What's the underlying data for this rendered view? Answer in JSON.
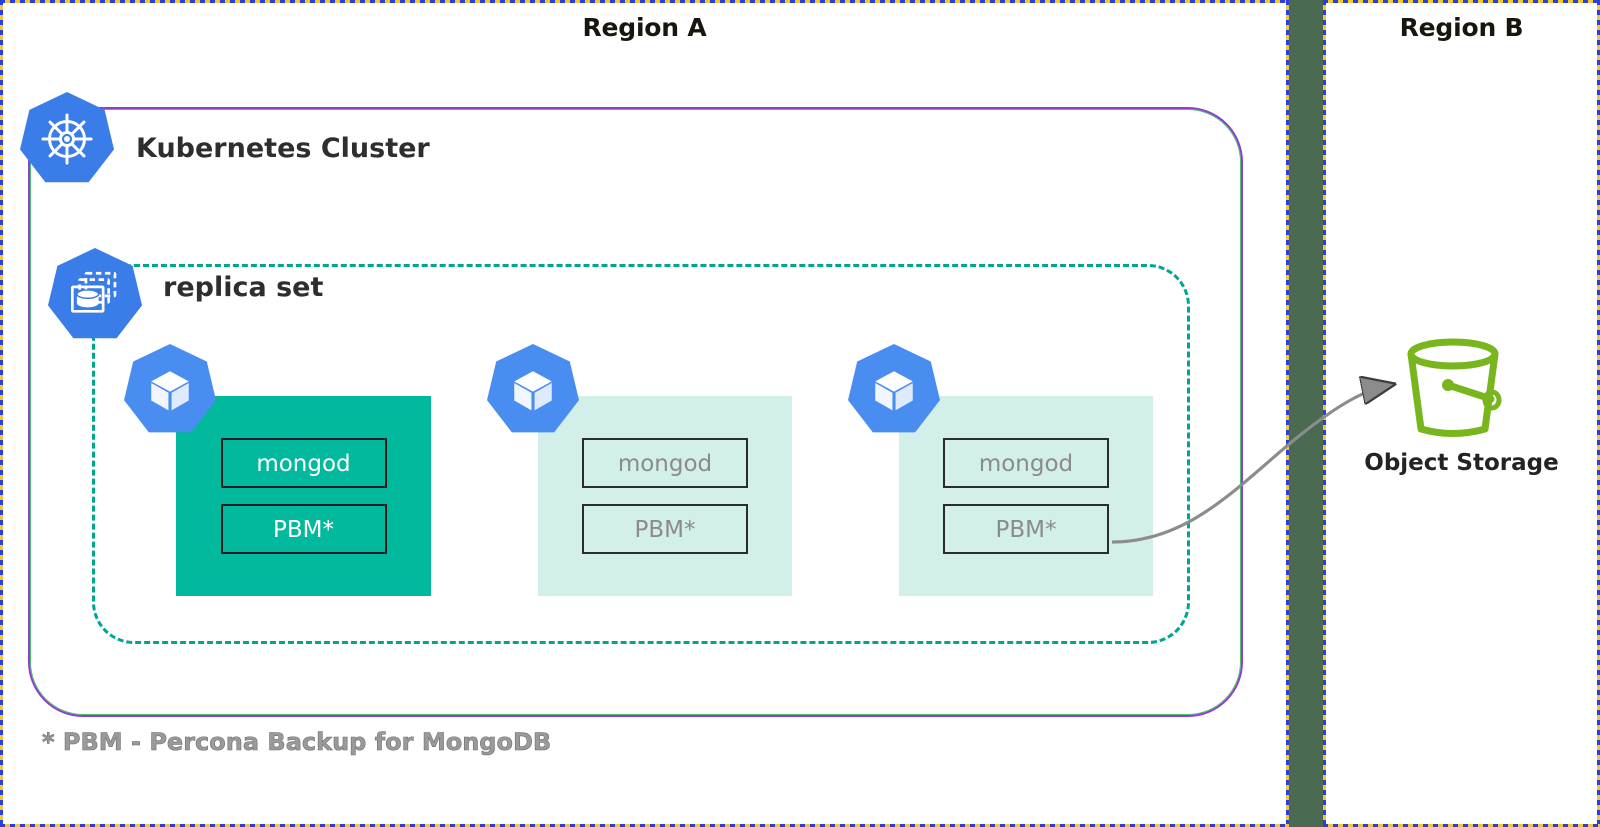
{
  "regions": {
    "a": {
      "title": "Region A"
    },
    "b": {
      "title": "Region B"
    }
  },
  "cluster": {
    "label": "Kubernetes Cluster",
    "icon": "kubernetes-helm-wheel-icon",
    "border_color": "#8e3fd0",
    "accent_color": "#49c26a"
  },
  "replica_set": {
    "label": "replica set",
    "icon": "replica-set-database-stack-icon",
    "border_color": "#00a592"
  },
  "pods": [
    {
      "role": "primary",
      "icon": "pod-cube-icon",
      "bg_color": "#03b99d",
      "text_color": "#ffffff",
      "containers": [
        {
          "label": "mongod"
        },
        {
          "label": "PBM*"
        }
      ]
    },
    {
      "role": "secondary",
      "icon": "pod-cube-icon",
      "bg_color": "#d3efe9",
      "text_color": "#8b8b8b",
      "containers": [
        {
          "label": "mongod"
        },
        {
          "label": "PBM*"
        }
      ]
    },
    {
      "role": "secondary",
      "icon": "pod-cube-icon",
      "bg_color": "#d3efe9",
      "text_color": "#8b8b8b",
      "containers": [
        {
          "label": "mongod"
        },
        {
          "label": "PBM*"
        }
      ]
    }
  ],
  "object_storage": {
    "label": "Object Storage",
    "icon": "bucket-icon",
    "icon_color": "#79b51c"
  },
  "connection": {
    "from": "pod-3-container-pbm",
    "to": "object-storage-bucket",
    "style": "curved-arrow",
    "color": "#8c8c8c"
  },
  "footnote": {
    "text": "* PBM - Percona Backup for MongoDB"
  },
  "canvas": {
    "background": "#4a6b52",
    "selection_border_colors": [
      "#2b3edb",
      "#efc93a"
    ]
  }
}
